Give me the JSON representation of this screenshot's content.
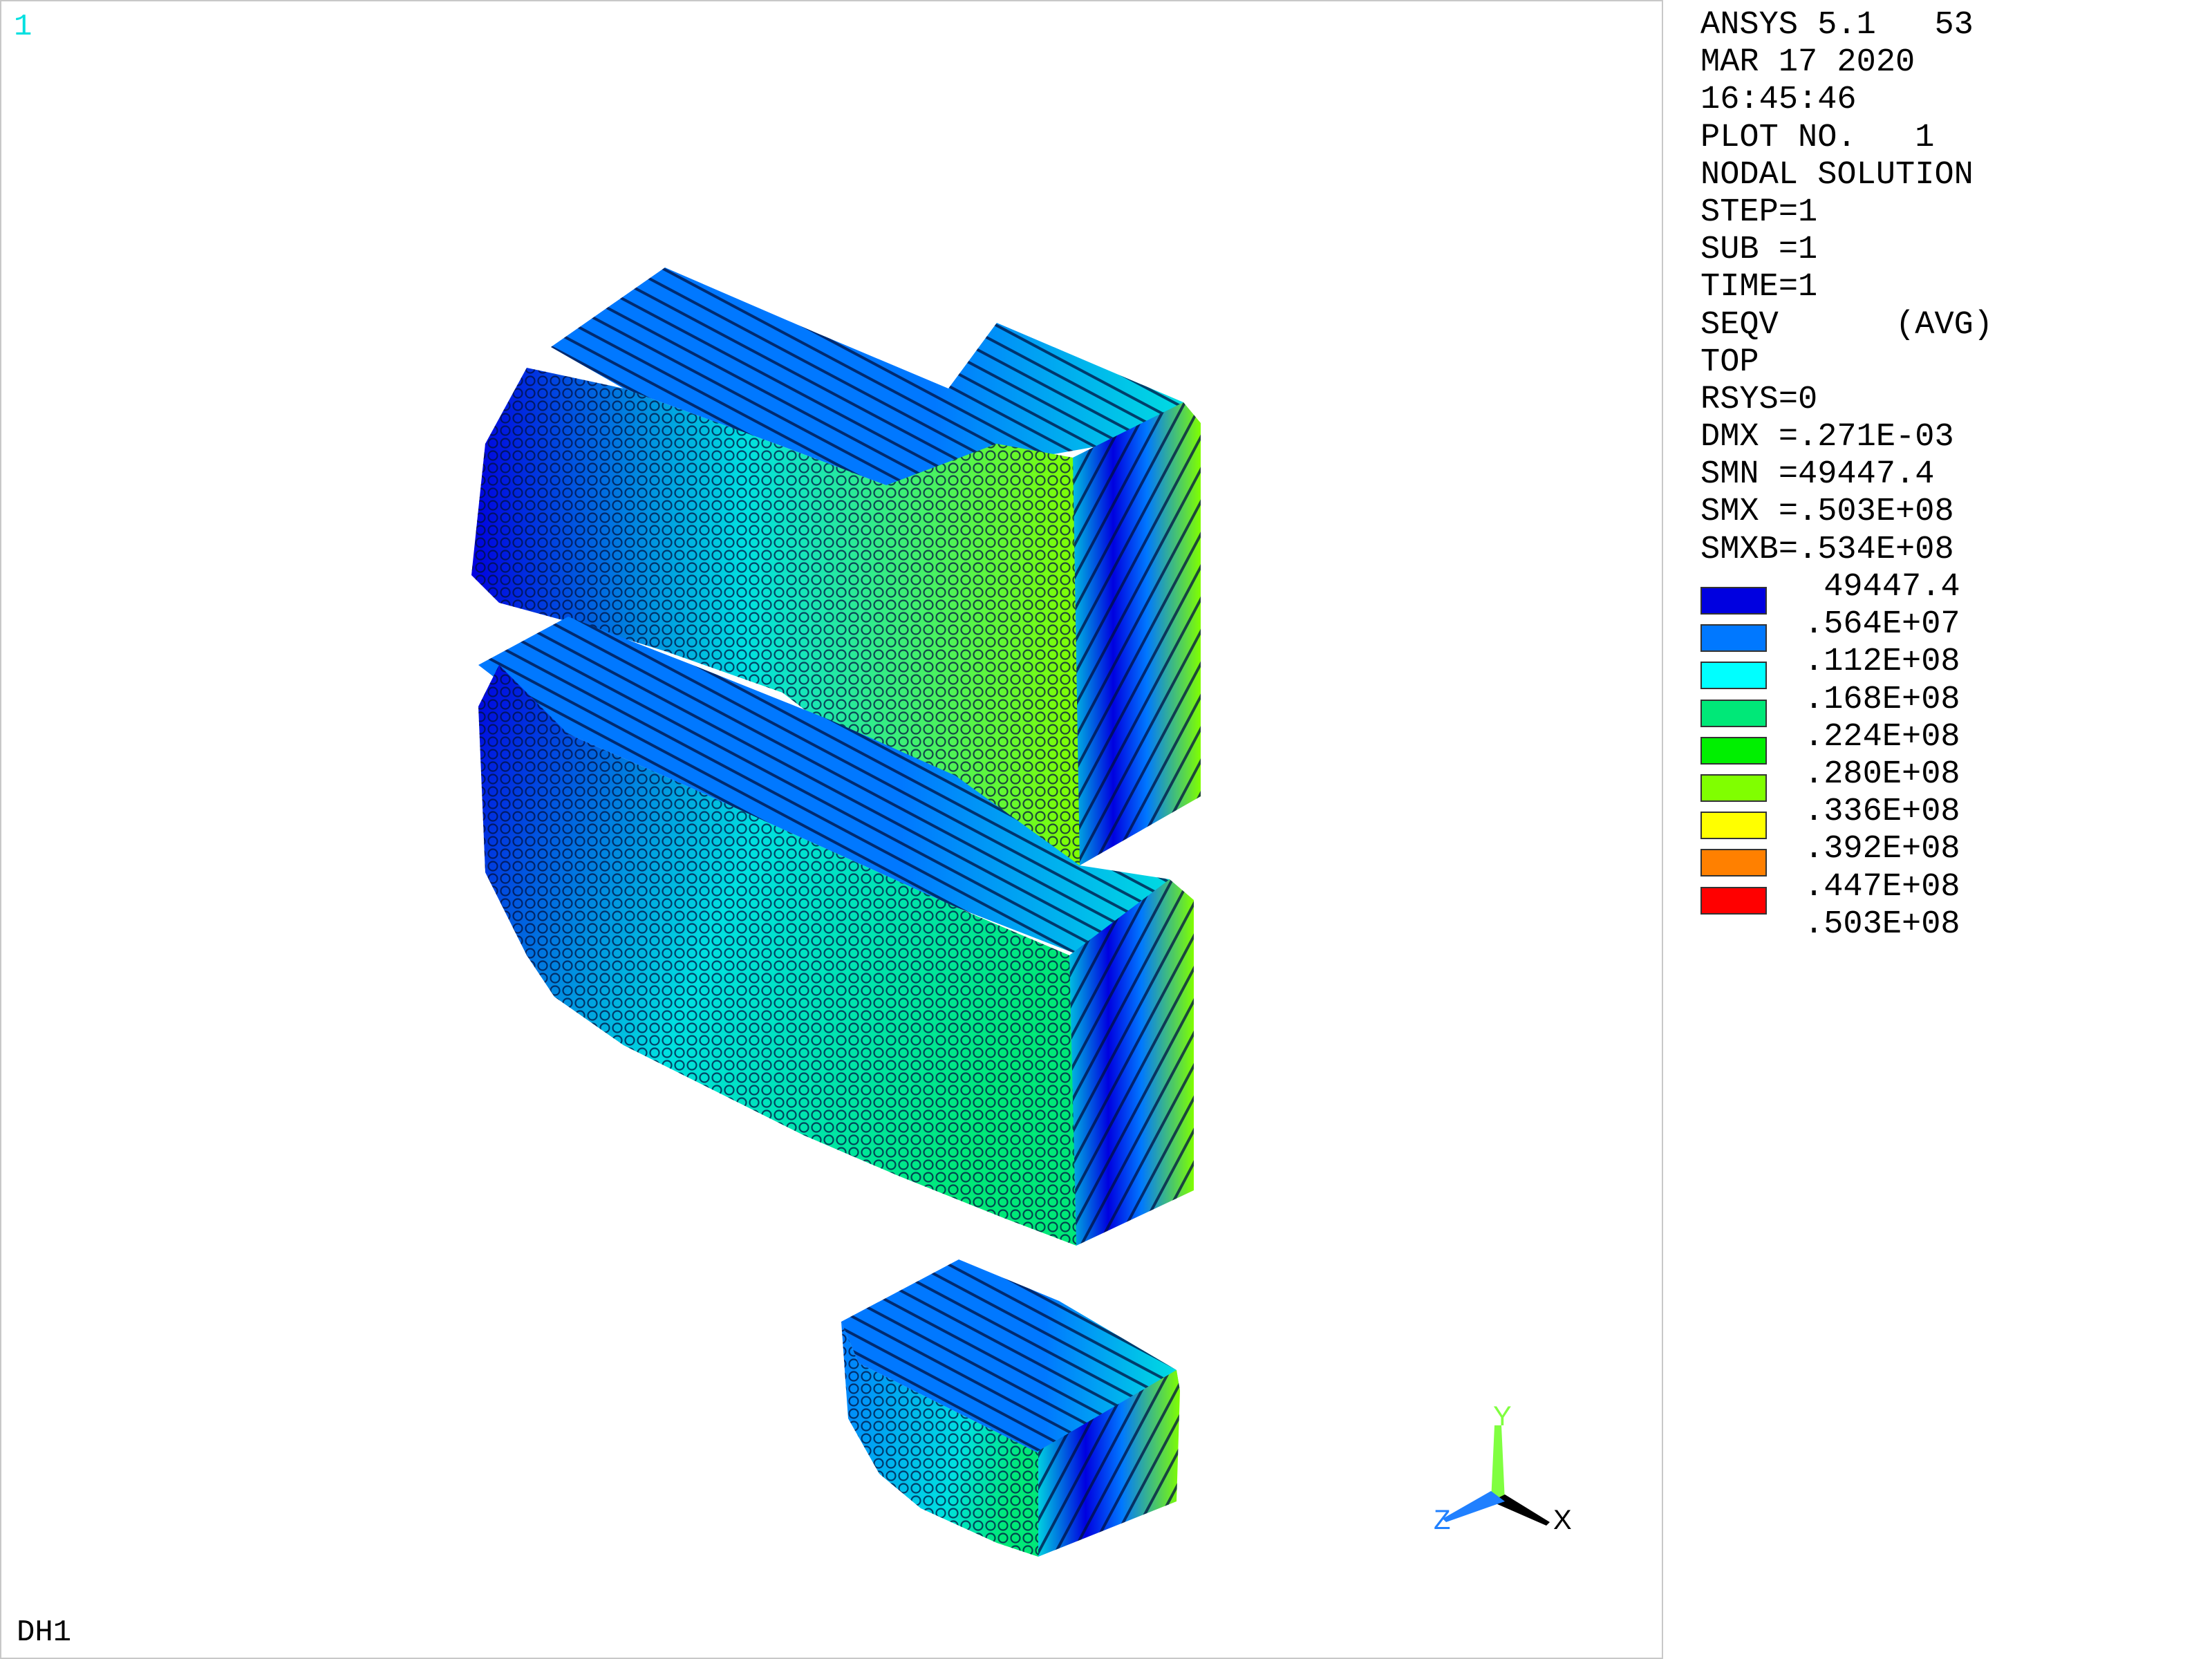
{
  "window": {
    "number": "1",
    "name": "DH1"
  },
  "info": {
    "lines": [
      "ANSYS 5.1   53",
      "MAR 17 2020",
      "16:45:46",
      "PLOT NO.   1",
      "NODAL SOLUTION",
      "STEP=1",
      "SUB =1",
      "TIME=1",
      "SEQV      (AVG)",
      "TOP",
      "RSYS=0",
      "DMX =.271E-03",
      "SMN =49447.4",
      "SMX =.503E+08",
      "SMXB=.534E+08"
    ]
  },
  "legend": {
    "labels": [
      " 49447.4",
      ".564E+07",
      ".112E+08",
      ".168E+08",
      ".224E+08",
      ".280E+08",
      ".336E+08",
      ".392E+08",
      ".447E+08",
      ".503E+08"
    ],
    "colors": [
      "#0000e0",
      "#0078ff",
      "#00ffff",
      "#00e878",
      "#00f000",
      "#80ff00",
      "#ffff00",
      "#ff8000",
      "#ff0000"
    ]
  },
  "triad": {
    "x_label": "X",
    "y_label": "Y",
    "z_label": "Z",
    "x_color": "#000000",
    "y_color": "#80ff40",
    "z_color": "#2080ff"
  },
  "model_colors": {
    "low": "#0000e0",
    "mid_low": "#0078ff",
    "mid": "#00e0e0",
    "mid_high": "#00e878",
    "high": "#80ff00",
    "edge": "#001040"
  }
}
